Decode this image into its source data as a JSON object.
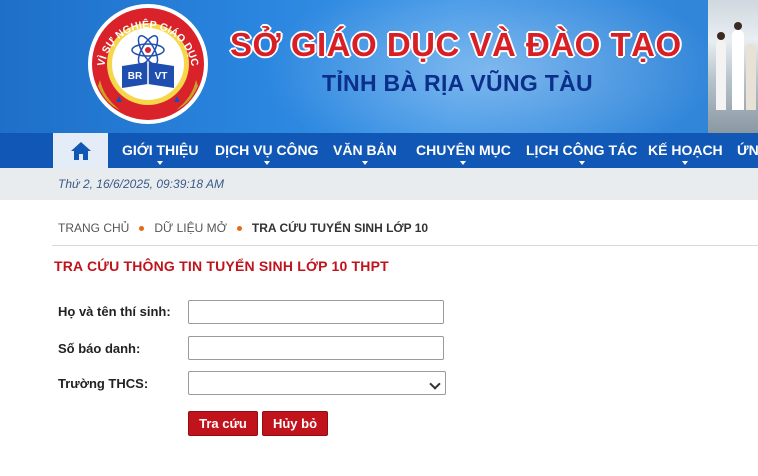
{
  "header": {
    "title": "SỞ GIÁO DỤC VÀ ĐÀO TẠO",
    "subtitle": "TỈNH BÀ RỊA VŨNG TÀU",
    "logo": {
      "ring_text": "VÌ SỰ NGHIỆP GIÁO DỤC",
      "left_letters": "BR",
      "right_letters": "VT"
    }
  },
  "nav": {
    "home_icon": "home-icon",
    "items": [
      {
        "label": "GIỚI THIỆU"
      },
      {
        "label": "DỊCH VỤ CÔNG"
      },
      {
        "label": "VĂN BẢN"
      },
      {
        "label": "CHUYÊN MỤC"
      },
      {
        "label": "LỊCH CÔNG TÁC"
      },
      {
        "label": "KẾ HOẠCH"
      },
      {
        "label": "ỨNG"
      }
    ]
  },
  "datetime": "Thứ 2, 16/6/2025, 09:39:18 AM",
  "breadcrumb": [
    "TRANG CHỦ",
    "DỮ LIỆU MỞ",
    "TRA CỨU TUYỂN SINH LỚP 10"
  ],
  "page_title": "TRA CỨU THÔNG TIN TUYỂN SINH LỚP 10 THPT",
  "form": {
    "name_label": "Họ và tên thí sinh:",
    "name_value": "",
    "id_label": "Số báo danh:",
    "id_value": "",
    "school_label": "Trường THCS:",
    "school_value": "",
    "search_button": "Tra cứu",
    "cancel_button": "Hủy bỏ"
  },
  "colors": {
    "nav_bg": "#1157b6",
    "title_red": "#d81f26",
    "subtitle_blue": "#0b2f8a",
    "button_red": "#c1131b",
    "breadcrumb_dot": "#e46a1a"
  }
}
